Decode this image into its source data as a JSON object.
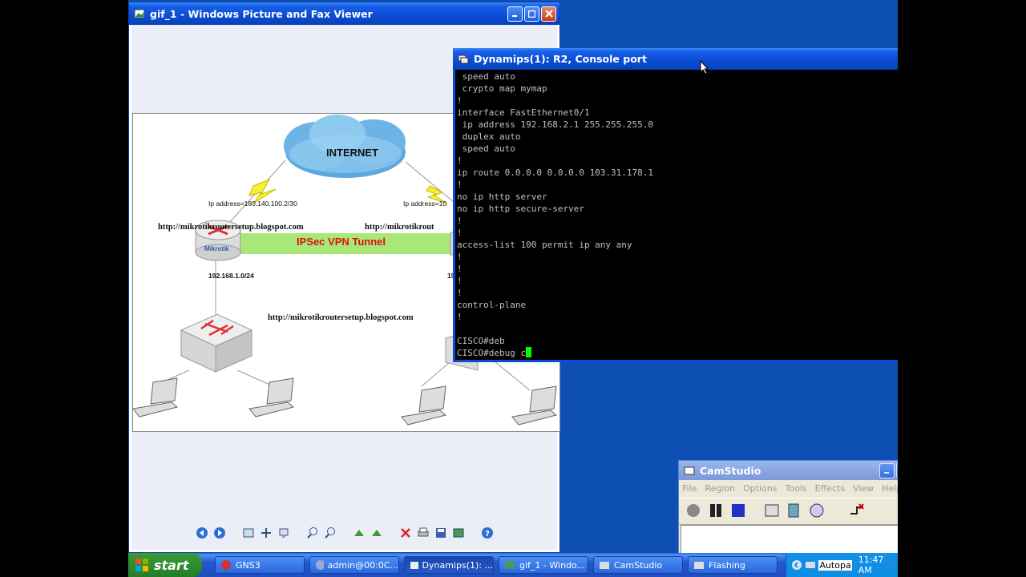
{
  "viewer": {
    "title": "gif_1 - Windows Picture and Fax Viewer",
    "diagram": {
      "cloud_label": "INTERNET",
      "ip_left": "Ip address=180.140.100.2/30",
      "ip_right": "Ip address=10",
      "url_left": "http://mikrotikroutersetup.blogspot.com",
      "url_right": "http://mikrotikrout",
      "url_center": "http://mikrotikroutersetup.blogspot.com",
      "router_label": "Mikrotik",
      "tunnel_label": "IPSec VPN Tunnel",
      "subnet_left": "192.168.1.0/24",
      "subnet_right": "19"
    }
  },
  "console": {
    "title": "Dynamips(1): R2, Console port",
    "lines": [
      " speed auto",
      " crypto map mymap",
      "!",
      "interface FastEthernet0/1",
      " ip address 192.168.2.1 255.255.255.0",
      " duplex auto",
      " speed auto",
      "!",
      "ip route 0.0.0.0 0.0.0.0 103.31.178.1",
      "!",
      "no ip http server",
      "no ip http secure-server",
      "!",
      "!",
      "access-list 100 permit ip any any",
      "!",
      "!",
      "!",
      "!",
      "control-plane",
      "!",
      "",
      "CISCO#deb"
    ],
    "prompt_line": "CISCO#debug c"
  },
  "camstudio": {
    "title": "CamStudio",
    "menu": [
      "File",
      "Region",
      "Options",
      "Tools",
      "Effects",
      "View",
      "Help"
    ]
  },
  "taskbar": {
    "start_label": "start",
    "tasks": [
      {
        "label": "GNS3"
      },
      {
        "label": "admin@00:0C..."
      },
      {
        "label": "Dynamips(1): ..."
      },
      {
        "label": "gif_1 - Windo..."
      },
      {
        "label": "CamStudio"
      },
      {
        "label": "Flashing"
      }
    ],
    "clock": "11:47 AM",
    "tray_text": "Autopa"
  },
  "colors": {
    "desktop": "#0e4fb4",
    "tunnel": "#a8e878",
    "tunnel_text": "#e01010",
    "terminal_bg": "#000000",
    "terminal_fg": "#c0c0c0",
    "cursor": "#00ff00"
  }
}
